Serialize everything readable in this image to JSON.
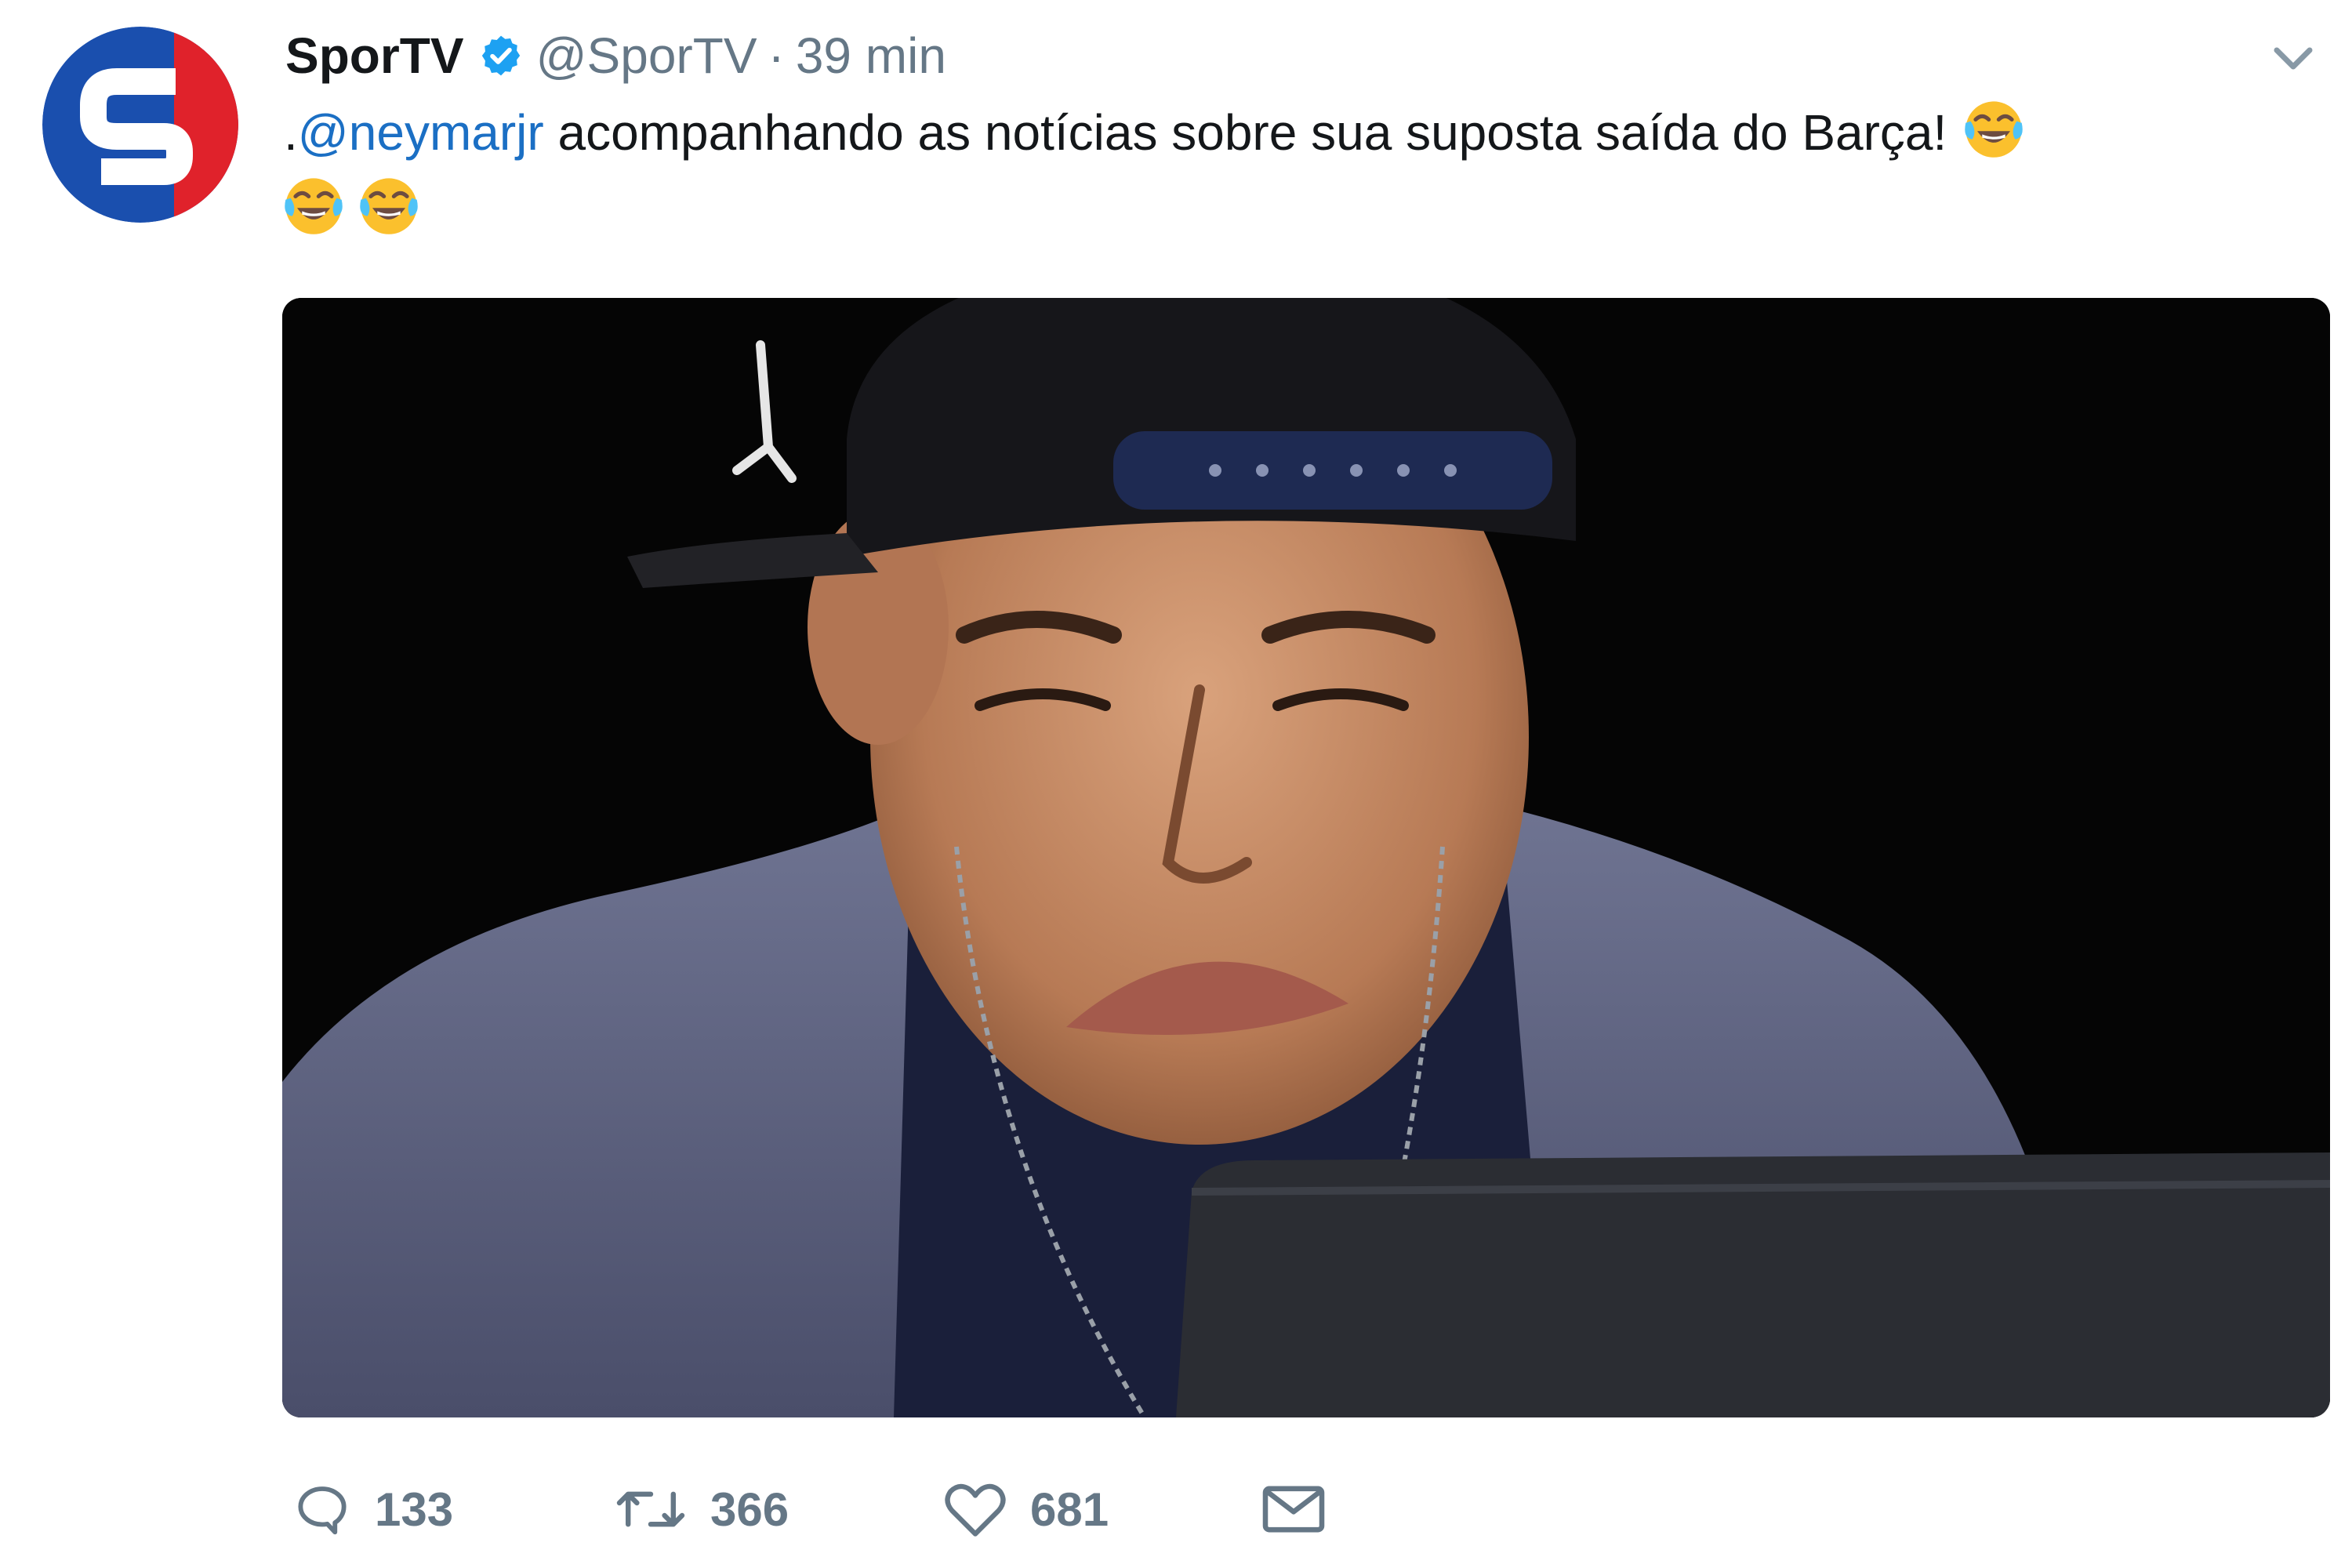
{
  "tweet": {
    "author_name": "SporTV",
    "author_handle": "@SporTV",
    "separator": "·",
    "timestamp": "39 min",
    "mention": "@neymarjr",
    "text_prefix": ".",
    "text_body": " acompanhando as notícias sobre sua suposta saída do Barça!",
    "emoji_after_text": "face-with-tears-of-joy-icon",
    "emoji_second_line": [
      "face-with-tears-of-joy-icon",
      "face-with-tears-of-joy-icon"
    ],
    "media": {
      "description_icon": "photo"
    }
  },
  "actions": {
    "reply_count": "133",
    "retweet_count": "366",
    "like_count": "681",
    "icons": [
      "reply-icon",
      "retweet-icon",
      "like-icon",
      "direct-message-icon"
    ]
  },
  "colors": {
    "brand_blue": "#1da1f2",
    "mention_blue": "#1b6fc4",
    "muted_gray": "#657786",
    "sportv_blue": "#1a4fae",
    "sportv_red": "#e0222b"
  }
}
